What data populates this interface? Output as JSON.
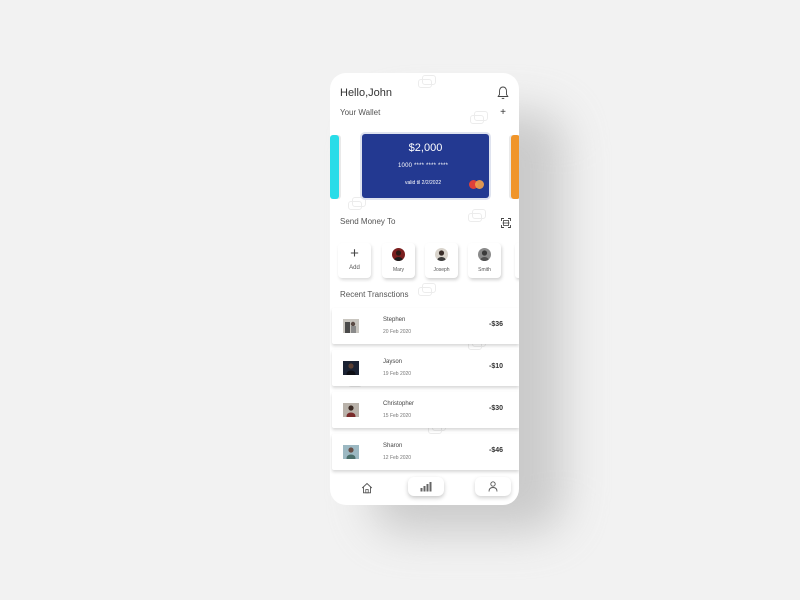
{
  "header": {
    "greeting": "Hello,John",
    "bell_icon": "bell-icon"
  },
  "wallet": {
    "title": "Your Wallet",
    "add_label": "+",
    "card": {
      "amount": "$2,000",
      "number": "1000 **** **** ****",
      "valid": "valid til 2/2/2022",
      "color": "#233991",
      "brand_icon": "mastercard-icon"
    },
    "side_cards": [
      {
        "color": "#29dce8"
      },
      {
        "color": "#f0952a"
      }
    ]
  },
  "send_money": {
    "title": "Send Money To",
    "qr_icon": "qr-scan-icon",
    "add": {
      "icon": "+",
      "label": "Add"
    },
    "contacts": [
      {
        "name": "Mary"
      },
      {
        "name": "Joseph"
      },
      {
        "name": "Smith"
      }
    ]
  },
  "recent": {
    "title": "Recent Transctions",
    "items": [
      {
        "name": "Stephen",
        "date": "20 Feb 2020",
        "amount": "-$36"
      },
      {
        "name": "Jayson",
        "date": "19 Feb 2020",
        "amount": "-$10"
      },
      {
        "name": "Christopher",
        "date": "15 Feb 2020",
        "amount": "-$30"
      },
      {
        "name": "Sharon",
        "date": "12 Feb 2020",
        "amount": "-$46"
      }
    ]
  },
  "nav": {
    "items": [
      {
        "icon": "home-icon"
      },
      {
        "icon": "stats-icon",
        "active": true
      },
      {
        "icon": "profile-icon"
      }
    ]
  }
}
